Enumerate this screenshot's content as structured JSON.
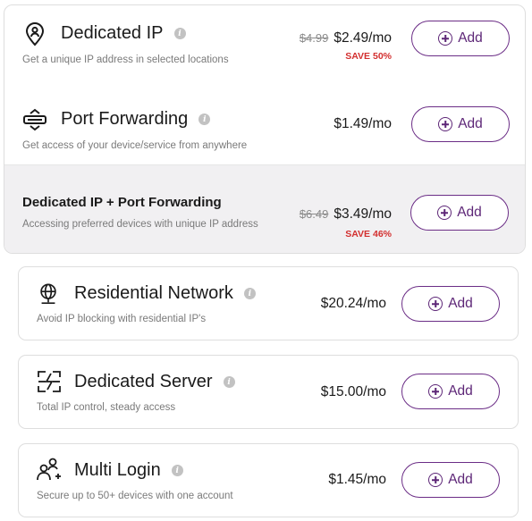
{
  "group": {
    "dedicated_ip": {
      "title": "Dedicated IP",
      "description": "Get a unique IP address in selected locations",
      "old_price": "$4.99",
      "price": "$2.49/mo",
      "save": "SAVE 50%",
      "icon": "location-pin-user-icon",
      "button_label": "Add"
    },
    "port_forwarding": {
      "title": "Port Forwarding",
      "description": "Get access of your device/service from anywhere",
      "price": "$1.49/mo",
      "icon": "port-forwarding-icon",
      "button_label": "Add"
    },
    "bundle": {
      "title": "Dedicated IP + Port Forwarding",
      "description": "Accessing preferred devices with unique IP address",
      "old_price": "$6.49",
      "price": "$3.49/mo",
      "save": "SAVE 46%",
      "button_label": "Add"
    }
  },
  "addons": [
    {
      "title": "Residential Network",
      "description": "Avoid IP blocking with residential IP's",
      "price": "$20.24/mo",
      "icon": "globe-network-icon",
      "button_label": "Add"
    },
    {
      "title": "Dedicated Server",
      "description": "Total IP control, steady access",
      "price": "$15.00/mo",
      "icon": "server-bolt-icon",
      "button_label": "Add"
    },
    {
      "title": "Multi Login",
      "description": "Secure up to 50+ devices with one account",
      "price": "$1.45/mo",
      "icon": "users-add-icon",
      "button_label": "Add"
    }
  ],
  "info_glyph": "i",
  "colors": {
    "accent": "#5d2677",
    "save": "#d32f2f",
    "bundle_bg": "#f1f0f2"
  }
}
